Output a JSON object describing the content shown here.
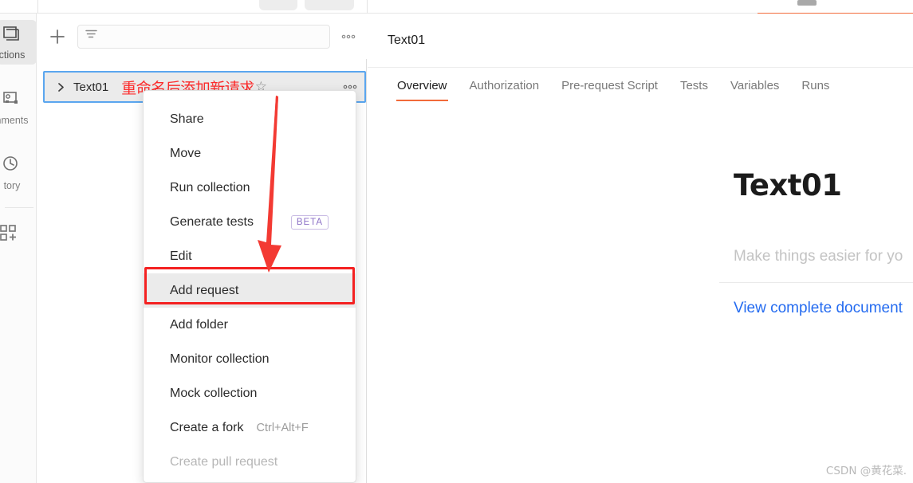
{
  "window": {
    "accent_orange": "#f26b3a",
    "selection_blue": "#5aa6ef",
    "annotation_red": "#fc2b2b",
    "link_blue": "#246bf0"
  },
  "rail": {
    "items": [
      {
        "label": "ctions",
        "icon": "collections-icon",
        "active": true
      },
      {
        "label": "nments",
        "icon": "environments-icon",
        "active": false
      },
      {
        "label": "tory",
        "icon": "history-icon",
        "active": false
      }
    ],
    "bottom_icon": "new-grid-plus-icon"
  },
  "sidebar": {
    "new_button": "+",
    "filter": {
      "value": "",
      "placeholder": "",
      "icon": "filter-icon"
    },
    "toolbar_more": "●●●",
    "collection": {
      "expand_icon": "chevron-right-icon",
      "name": "Text01",
      "annotation": "重命名后添加新请求",
      "star": "☆",
      "more": "●●●"
    }
  },
  "context_menu": {
    "items": [
      {
        "label": "Share",
        "badge": "",
        "shortcut": "",
        "highlighted": false,
        "disabled": false
      },
      {
        "label": "Move",
        "badge": "",
        "shortcut": "",
        "highlighted": false,
        "disabled": false
      },
      {
        "label": "Run collection",
        "badge": "",
        "shortcut": "",
        "highlighted": false,
        "disabled": false
      },
      {
        "label": "Generate tests",
        "badge": "BETA",
        "shortcut": "",
        "highlighted": false,
        "disabled": false
      },
      {
        "label": "Edit",
        "badge": "",
        "shortcut": "",
        "highlighted": false,
        "disabled": false
      },
      {
        "label": "Add request",
        "badge": "",
        "shortcut": "",
        "highlighted": true,
        "disabled": false
      },
      {
        "label": "Add folder",
        "badge": "",
        "shortcut": "",
        "highlighted": false,
        "disabled": false
      },
      {
        "label": "Monitor collection",
        "badge": "",
        "shortcut": "",
        "highlighted": false,
        "disabled": false
      },
      {
        "label": "Mock collection",
        "badge": "",
        "shortcut": "",
        "highlighted": false,
        "disabled": false
      },
      {
        "label": "Create a fork",
        "badge": "",
        "shortcut": "Ctrl+Alt+F",
        "highlighted": false,
        "disabled": false
      },
      {
        "label": "Create pull request",
        "badge": "",
        "shortcut": "",
        "highlighted": false,
        "disabled": true
      }
    ]
  },
  "main": {
    "title": "Text01",
    "tabs": [
      {
        "label": "Overview",
        "active": true
      },
      {
        "label": "Authorization",
        "active": false
      },
      {
        "label": "Pre-request Script",
        "active": false
      },
      {
        "label": "Tests",
        "active": false
      },
      {
        "label": "Variables",
        "active": false
      },
      {
        "label": "Runs",
        "active": false
      }
    ],
    "document": {
      "heading": "Text01",
      "subtitle": "Make things easier for yo",
      "link": "View complete document"
    }
  },
  "watermark": "CSDN @黄花菜."
}
